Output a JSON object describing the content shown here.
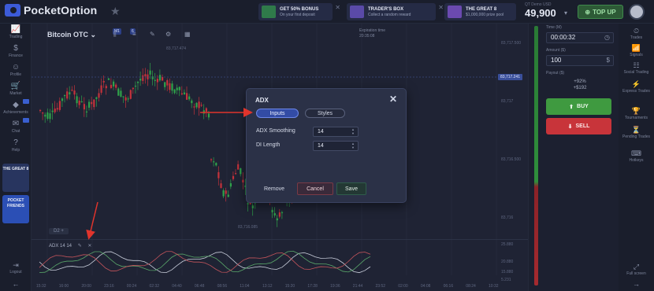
{
  "app": {
    "logo": "PocketOption"
  },
  "promos": [
    {
      "title": "GET 50% BONUS",
      "subtitle": "On your first deposit"
    },
    {
      "title": "TRADER'S BOX",
      "subtitle": "Collect a random reward"
    },
    {
      "title": "THE GREAT 8",
      "subtitle": "$1,000,000 prize pool"
    }
  ],
  "account": {
    "type": "QT Demo USD",
    "balance": "49,900",
    "topup_label": "TOP UP"
  },
  "left_nav": [
    {
      "icon": "trading-icon",
      "label": "Trading"
    },
    {
      "icon": "finance-icon",
      "label": "Finance"
    },
    {
      "icon": "profile-icon",
      "label": "Profile"
    },
    {
      "icon": "market-icon",
      "label": "Market"
    },
    {
      "icon": "achievements-icon",
      "label": "Achievements"
    },
    {
      "icon": "chat-icon",
      "label": "Chat"
    },
    {
      "icon": "help-icon",
      "label": "Help"
    }
  ],
  "left_cards": {
    "great8": "THE GREAT 8",
    "friends": "POCKET FRIENDS"
  },
  "left_bottom": {
    "logout": "Logout"
  },
  "toolbar": {
    "asset": "Bitcoin OTC",
    "timeframe_badge": "M1",
    "candles_badge": "6",
    "asset_chevron": "⌄"
  },
  "chart": {
    "expiry_label": "Expiration time",
    "expiry_value": "20:35:08",
    "current_price": "83,717.241",
    "high_label": "83,717.474",
    "low_label": "83,716.085",
    "y_labels": [
      "83,717.500",
      "83,717",
      "83,716.500",
      "83,716",
      "25.880",
      "20.880",
      "15.880",
      "5.231"
    ],
    "x_labels": [
      "15:32",
      "16:00",
      "20:00",
      "23:16",
      "00:24",
      "02:32",
      "04:40",
      "06:48",
      "08:56",
      "11:04",
      "13:12",
      "15:20",
      "17:28",
      "19:36",
      "21:44",
      "23:52",
      "02:00",
      "04:08",
      "06:16",
      "08:24",
      "10:32"
    ],
    "zoom_tag": "D2",
    "indicator_label": "ADX 14 14"
  },
  "modal": {
    "title": "ADX",
    "tabs": [
      "Inputs",
      "Styles"
    ],
    "fields": [
      {
        "label": "ADX Smoothing",
        "value": "14"
      },
      {
        "label": "DI Length",
        "value": "14"
      }
    ],
    "buttons": {
      "remove": "Remove",
      "cancel": "Cancel",
      "save": "Save"
    }
  },
  "trade_panel": {
    "time_label": "Time (M)",
    "time_value": "00:00:32",
    "amount_label": "Amount ($)",
    "amount_value": "100",
    "payout_label": "Payout ($)",
    "payout_percent": "+92%",
    "payout_value": "+$192",
    "buy_label": "BUY",
    "sell_label": "SELL"
  },
  "right_nav": [
    {
      "icon": "trades-icon",
      "label": "Trades"
    },
    {
      "icon": "signals-icon",
      "label": "Signals"
    },
    {
      "icon": "social-trading-icon",
      "label": "Social Trading"
    },
    {
      "icon": "express-trades-icon",
      "label": "Express Trades"
    },
    {
      "icon": "tournaments-icon",
      "label": "Tournaments"
    },
    {
      "icon": "pending-trades-icon",
      "label": "Pending Trades"
    },
    {
      "icon": "hotkeys-icon",
      "label": "Hotkeys"
    }
  ],
  "full_screen_label": "Full screen",
  "colors": {
    "buy": "#3f9a40",
    "sell": "#c8343a",
    "accent": "#3c5bd8",
    "annotation": "#e0342c"
  }
}
